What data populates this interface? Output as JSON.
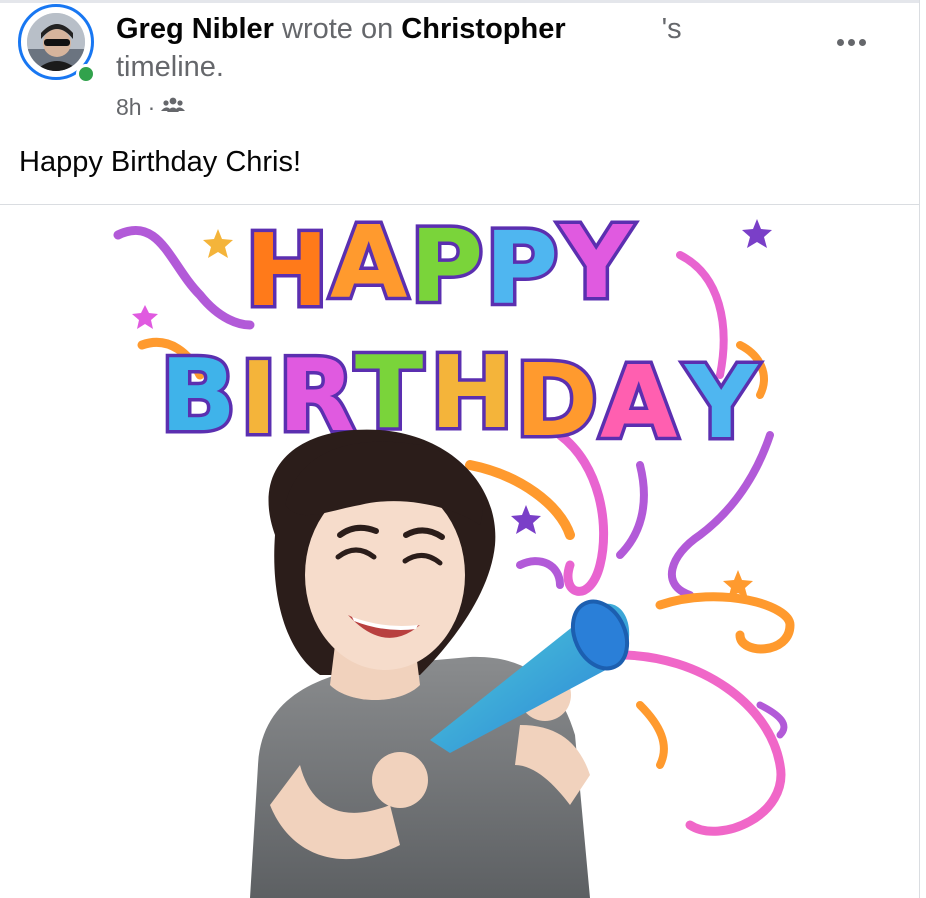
{
  "post": {
    "author": "Greg Nibler",
    "verb": "wrote on",
    "target": "Christopher",
    "possessive": "'s",
    "suffix": "timeline.",
    "time": "8h",
    "separator": "·",
    "audience_icon": "friends-icon",
    "more_icon": "more-options-icon",
    "text": "Happy Birthday Chris!"
  },
  "sticker": {
    "line1": "HAPPY",
    "line2": "BIRTHDAY",
    "letter_colors": [
      "#ff7a1a",
      "#ff9a2e",
      "#7ad43a",
      "#4fb6f0",
      "#e05ae0",
      "#f4b43a",
      "#3fb3ea",
      "#7ad43a",
      "#ff5fb0",
      "#f4b43a",
      "#e05ae0",
      "#4fb6f0"
    ],
    "ribbon_colors": [
      "#c95fe6",
      "#ff8a1e",
      "#f067c8"
    ]
  },
  "colors": {
    "ring": "#1877f2",
    "online": "#31a24c",
    "secondary_text": "#65676b"
  }
}
